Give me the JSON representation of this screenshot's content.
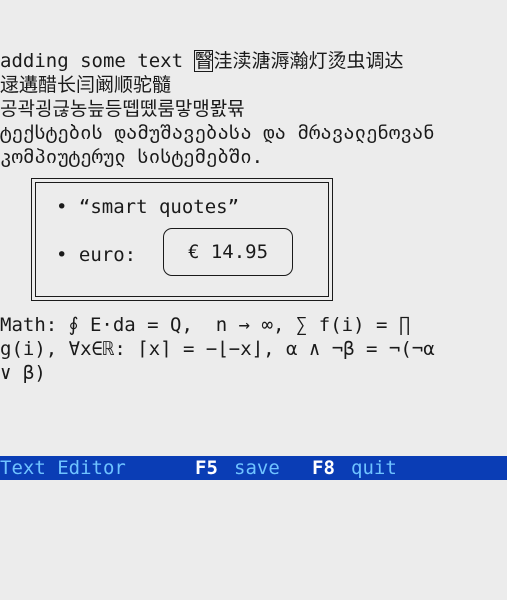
{
  "editor": {
    "line1_prefix": "adding some text ",
    "cursor_char": "瞖",
    "line1_rest": "洼渎溏溽瀚灯烫虫调达",
    "line2": "逯遘醋长闫阚顺驼髓",
    "line3": "공곽굉귾농늪등뗍뗐룸맣맹뫐뮦",
    "line4": "ტექსტების დამუშავებასა და მრავალენოვან",
    "line5": "კომპიუტერულ სისტემებში.",
    "bullet1": "• “smart quotes”",
    "bullet2_label": "• euro:",
    "price": "€ 14.95",
    "math_line1": "Math: ∮ E⋅da = Q,  n → ∞, ∑ f(i) = ∏",
    "math_line2": "g(i), ∀x∈ℝ: ⌈x⌉ = −⌊−x⌋, α ∧ ¬β = ¬(¬α",
    "math_line3": "∨ β)"
  },
  "statusbar": {
    "title": "Text Editor",
    "key1": "F5",
    "action1": "save",
    "key2": "F8",
    "action2": "quit"
  },
  "colors": {
    "statusbar_bg": "#0a3db5",
    "statusbar_text": "#6fc3ff",
    "statusbar_key": "#ffffff"
  }
}
